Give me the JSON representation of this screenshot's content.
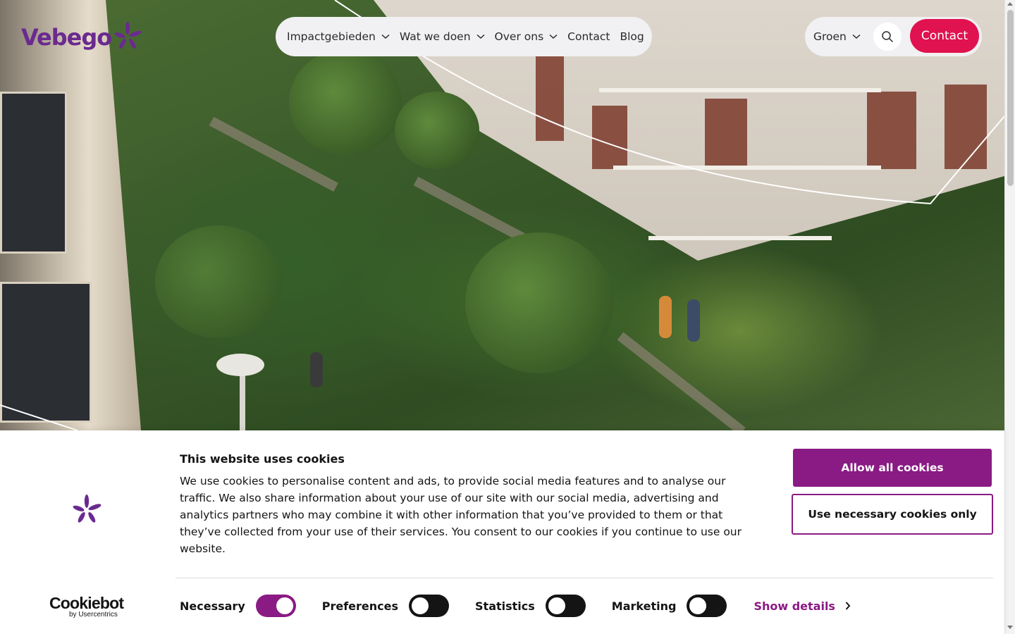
{
  "header": {
    "logo_text": "Vebego",
    "nav": [
      {
        "label": "Impactgebieden",
        "has_dropdown": true
      },
      {
        "label": "Wat we doen",
        "has_dropdown": true
      },
      {
        "label": "Over ons",
        "has_dropdown": true
      },
      {
        "label": "Contact",
        "has_dropdown": false
      },
      {
        "label": "Blog",
        "has_dropdown": false
      }
    ],
    "language": "Groen",
    "search_icon": "search-icon",
    "contact_label": "Contact"
  },
  "cookie_banner": {
    "title": "This website uses cookies",
    "text": "We use cookies to personalise content and ads, to provide social media features and to analyse our traffic. We also share information about your use of our site with our social media, advertising and analytics partners who may combine it with other information that you’ve provided to them or that they’ve collected from your use of their services. You consent to our cookies if you continue to use our website.",
    "allow_all": "Allow all cookies",
    "necessary_only": "Use necessary cookies only",
    "toggles": [
      {
        "label": "Necessary",
        "on": true
      },
      {
        "label": "Preferences",
        "on": false
      },
      {
        "label": "Statistics",
        "on": false
      },
      {
        "label": "Marketing",
        "on": false
      }
    ],
    "show_details": "Show details",
    "brand": "Cookiebot",
    "brand_sub": "by Usercentrics"
  },
  "colors": {
    "brand_purple": "#6b2a8f",
    "contact_red": "#e0124f",
    "cookie_purple": "#8a1a84"
  }
}
